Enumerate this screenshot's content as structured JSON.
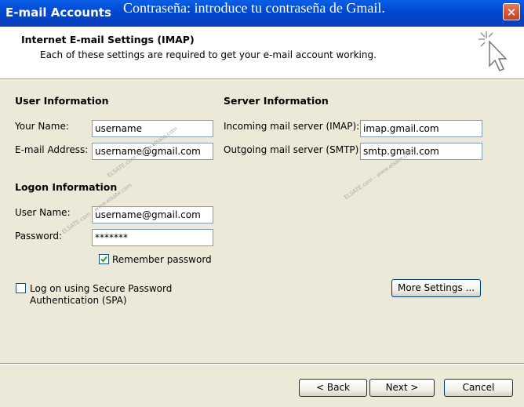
{
  "window": {
    "title": "E-mail Accounts",
    "caption": "Contraseña: introduce tu contraseña de Gmail.",
    "close_label": "✕"
  },
  "header": {
    "title": "Internet E-mail Settings (IMAP)",
    "subtitle": "Each of these settings are required to get your e-mail account working."
  },
  "user_info": {
    "section_label": "User Information",
    "name_label": "Your Name:",
    "name_value": "username",
    "email_label": "E-mail Address:",
    "email_value": "username@gmail.com"
  },
  "server_info": {
    "section_label": "Server Information",
    "incoming_label": "Incoming mail server (IMAP):",
    "incoming_value": "imap.gmail.com",
    "outgoing_label": "Outgoing mail server (SMTP):",
    "outgoing_value": "smtp.gmail.com"
  },
  "logon_info": {
    "section_label": "Logon Information",
    "user_label": "User Name:",
    "user_value": "username@gmail.com",
    "password_label": "Password:",
    "password_value": "*******",
    "remember_label": "Remember password",
    "remember_checked": true,
    "spa_label_line1": "Log on using Secure Password",
    "spa_label_line2": "Authentication (SPA)",
    "spa_checked": false
  },
  "buttons": {
    "more_settings": "More Settings ...",
    "back": "< Back",
    "next": "Next >",
    "cancel": "Cancel"
  },
  "watermark": "ELSATE.com - www.elsate.com"
}
